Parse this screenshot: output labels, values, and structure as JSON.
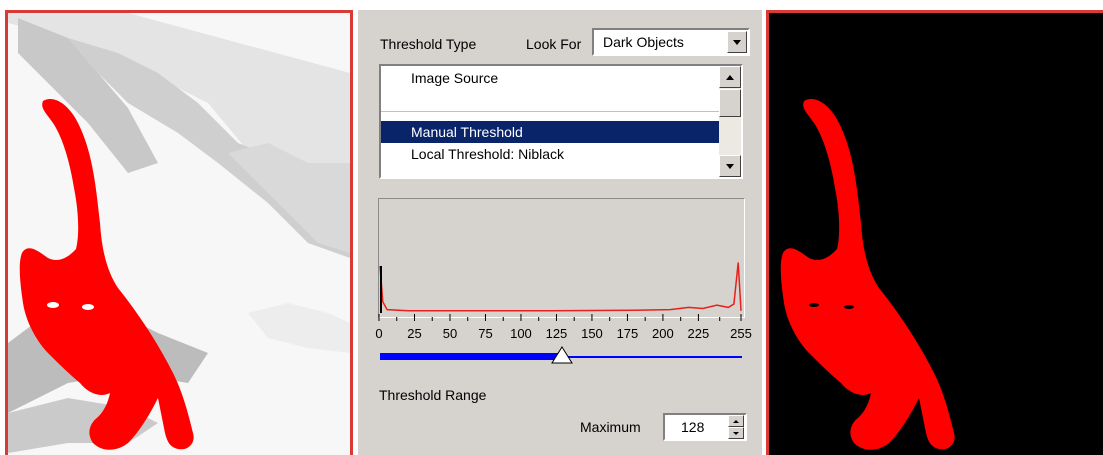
{
  "settings": {
    "threshold_type_label": "Threshold Type",
    "look_for_label": "Look For",
    "look_for_value": "Dark Objects",
    "method_list": {
      "items": [
        {
          "label": "Image Source",
          "selected": false
        },
        {
          "label": "",
          "selected": false
        },
        {
          "label": "Manual Threshold",
          "selected": true
        },
        {
          "label": "Local Threshold: Niblack",
          "selected": false
        }
      ]
    },
    "histogram": {
      "x_ticks": [
        "0",
        "25",
        "50",
        "75",
        "100",
        "125",
        "150",
        "175",
        "200",
        "225",
        "255"
      ],
      "tick_values": [
        0,
        25,
        50,
        75,
        100,
        125,
        150,
        175,
        200,
        225,
        255
      ],
      "x_range": [
        0,
        255
      ],
      "line_color": "#e8201c",
      "bin_values": [
        [
          0,
          0.42
        ],
        [
          2,
          0.1
        ],
        [
          5,
          0.03
        ],
        [
          20,
          0.02
        ],
        [
          60,
          0.02
        ],
        [
          120,
          0.02
        ],
        [
          180,
          0.025
        ],
        [
          205,
          0.03
        ],
        [
          218,
          0.05
        ],
        [
          228,
          0.04
        ],
        [
          238,
          0.07
        ],
        [
          246,
          0.05
        ],
        [
          250,
          0.08
        ],
        [
          253,
          0.45
        ],
        [
          255,
          0.02
        ]
      ]
    },
    "slider": {
      "value": 128,
      "fill_color": "#0000ff"
    },
    "threshold_range_label": "Threshold Range",
    "maximum_label": "Maximum",
    "maximum_value": "128"
  },
  "colors": {
    "panel_border": "#d93a35",
    "object_red": "#ff0000",
    "selection": "#0a246a",
    "dialog_bg": "#d6d3ce"
  },
  "icons": {
    "combo_arrow": "chevron-down-icon",
    "scroll_up": "arrow-up-icon",
    "scroll_down": "arrow-down-icon",
    "slider_thumb": "triangle-thumb-icon"
  }
}
